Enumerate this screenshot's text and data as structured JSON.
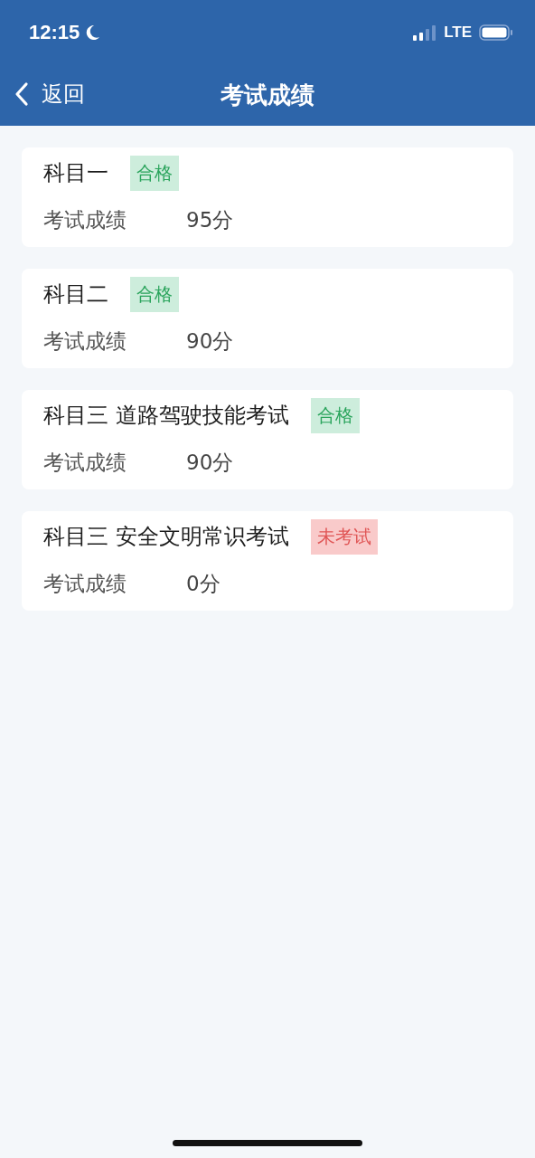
{
  "status_bar": {
    "time": "12:15",
    "network": "LTE"
  },
  "nav": {
    "back_label": "返回",
    "title": "考试成绩"
  },
  "results": [
    {
      "subject": "科目一",
      "badge": "合格",
      "kind": "pass",
      "score_label": "考试成绩",
      "score": "95分"
    },
    {
      "subject": "科目二",
      "badge": "合格",
      "kind": "pass",
      "score_label": "考试成绩",
      "score": "90分"
    },
    {
      "subject": "科目三 道路驾驶技能考试",
      "badge": "合格",
      "kind": "pass",
      "score_label": "考试成绩",
      "score": "90分"
    },
    {
      "subject": "科目三 安全文明常识考试",
      "badge": "未考试",
      "kind": "not_taken",
      "score_label": "考试成绩",
      "score": "0分"
    }
  ]
}
